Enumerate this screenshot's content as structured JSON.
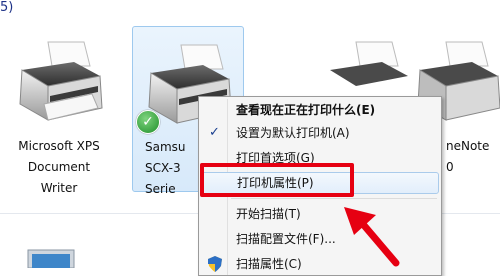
{
  "header": {
    "fragment": "5)"
  },
  "devices": [
    {
      "label_lines": [
        "Microsoft XPS",
        "Document",
        "Writer"
      ]
    },
    {
      "label_lines": [
        "Samsu",
        "SCX-3",
        "Serie"
      ],
      "selected": true,
      "default_badge": "✓"
    },
    {
      "label_lines": [
        "neNote",
        "0"
      ]
    }
  ],
  "context_menu": {
    "items": [
      {
        "label": "查看现在正在打印什么(E)",
        "bold": true
      },
      {
        "label": "设置为默认打印机(A)",
        "checked": true,
        "check_glyph": "✓"
      },
      {
        "label": "打印首选项(G)"
      },
      {
        "label": "打印机属性(P)",
        "highlighted": true
      },
      {
        "label": "开始扫描(T)"
      },
      {
        "label": "扫描配置文件(F)..."
      },
      {
        "label": "扫描属性(C)",
        "icon": "shield-icon"
      }
    ]
  },
  "annotation": {
    "box_color": "#e60012",
    "arrow_color": "#e60012"
  },
  "colors": {
    "selection_bg": "#d7e9fa",
    "selection_border": "#9ec9ee",
    "menu_bg": "#f5f5f5"
  }
}
